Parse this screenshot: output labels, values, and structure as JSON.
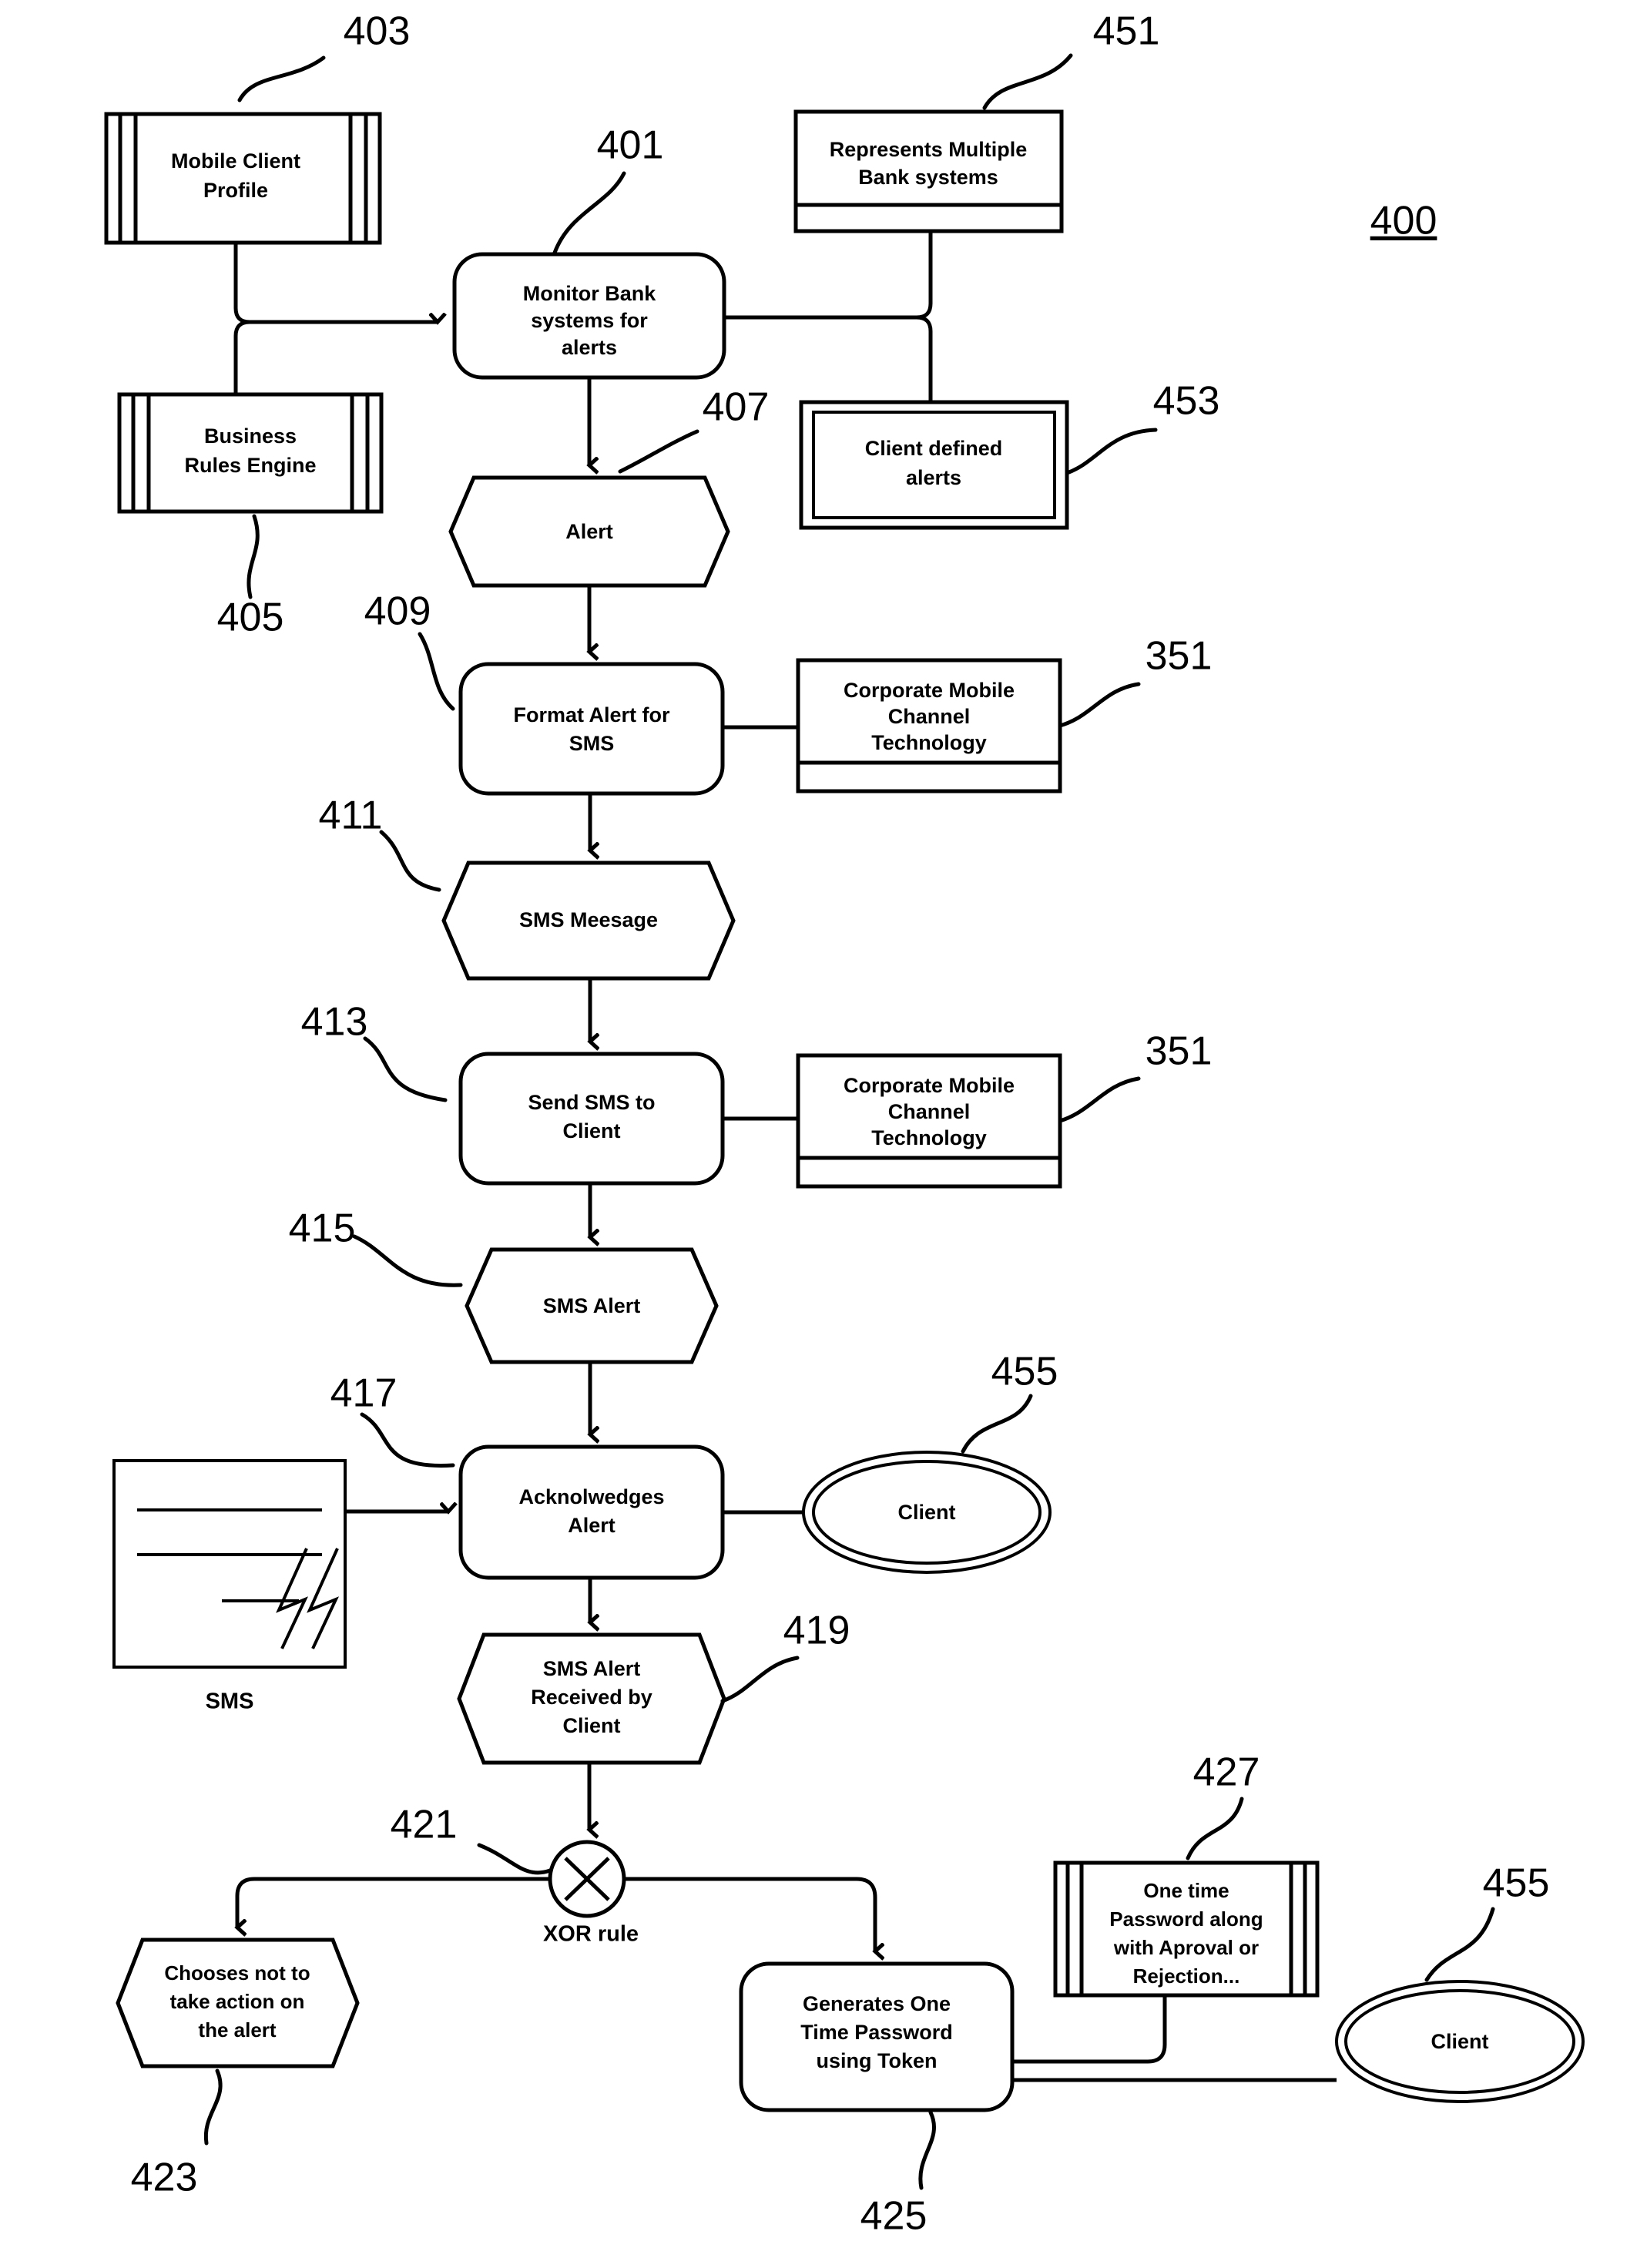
{
  "figure": {
    "number": "400",
    "title_ref": "400"
  },
  "nodes": {
    "mobile_client_profile": {
      "ref": "403",
      "label_line1": "Mobile Client",
      "label_line2": "Profile",
      "shape": "multi-page-box"
    },
    "business_rules_engine": {
      "ref": "405",
      "label_line1": "Business",
      "label_line2": "Rules Engine",
      "shape": "multi-page-box"
    },
    "monitor_bank_systems": {
      "ref": "401",
      "label_line1": "Monitor Bank",
      "label_line2": "systems for",
      "label_line3": "alerts",
      "shape": "rounded-process"
    },
    "represents_multiple_bank_systems": {
      "ref": "451",
      "label_line1": "Represents Multiple",
      "label_line2": "Bank systems",
      "shape": "document-box"
    },
    "client_defined_alerts": {
      "ref": "453",
      "label_line1": "Client defined",
      "label_line2": "alerts",
      "shape": "double-box"
    },
    "alert": {
      "ref": "407",
      "label_line1": "Alert",
      "shape": "hexagon"
    },
    "format_alert_for_sms": {
      "ref": "409",
      "label_line1": "Format Alert for",
      "label_line2": "SMS",
      "shape": "rounded-process"
    },
    "corporate_mobile_channel_technology_1": {
      "ref": "351",
      "label_line1": "Corporate Mobile",
      "label_line2": "Channel",
      "label_line3": "Technology",
      "shape": "document-box"
    },
    "sms_message": {
      "ref": "411",
      "label_line1": "SMS Meesage",
      "shape": "hexagon"
    },
    "send_sms_to_client": {
      "ref": "413",
      "label_line1": "Send SMS to",
      "label_line2": "Client",
      "shape": "rounded-process"
    },
    "corporate_mobile_channel_technology_2": {
      "ref": "351",
      "label_line1": "Corporate Mobile",
      "label_line2": "Channel",
      "label_line3": "Technology",
      "shape": "document-box"
    },
    "sms_alert": {
      "ref": "415",
      "label_line1": "SMS Alert",
      "shape": "hexagon"
    },
    "acknowledges_alert": {
      "ref": "417",
      "label_line1": "Acknolwedges",
      "label_line2": "Alert",
      "shape": "rounded-process"
    },
    "sms_device": {
      "caption": "SMS",
      "shape": "sms-icon"
    },
    "client_top": {
      "ref": "455",
      "label_line1": "Client",
      "shape": "double-ellipse"
    },
    "sms_alert_received_by_client": {
      "ref": "419",
      "label_line1": "SMS Alert",
      "label_line2": "Received by",
      "label_line3": "Client",
      "shape": "hexagon"
    },
    "xor_gateway": {
      "ref": "421",
      "caption": "XOR rule",
      "shape": "xor-circle"
    },
    "chooses_not_to_take_action": {
      "ref": "423",
      "label_line1": "Chooses not to",
      "label_line2": "take action on",
      "label_line3": "the alert",
      "shape": "hexagon"
    },
    "generates_one_time_password": {
      "ref": "425",
      "label_line1": "Generates One",
      "label_line2": "Time Password",
      "label_line3": "using Token",
      "shape": "rounded-process"
    },
    "one_time_password_note": {
      "ref": "427",
      "label_line1": "One time",
      "label_line2": "Password along",
      "label_line3": "with Aproval or",
      "label_line4": "Rejection...",
      "shape": "multi-page-box"
    },
    "client_bottom": {
      "ref": "455",
      "label_line1": "Client",
      "shape": "double-ellipse"
    }
  },
  "colors": {
    "stroke": "#000000",
    "fill": "#ffffff",
    "background": "#ffffff"
  }
}
